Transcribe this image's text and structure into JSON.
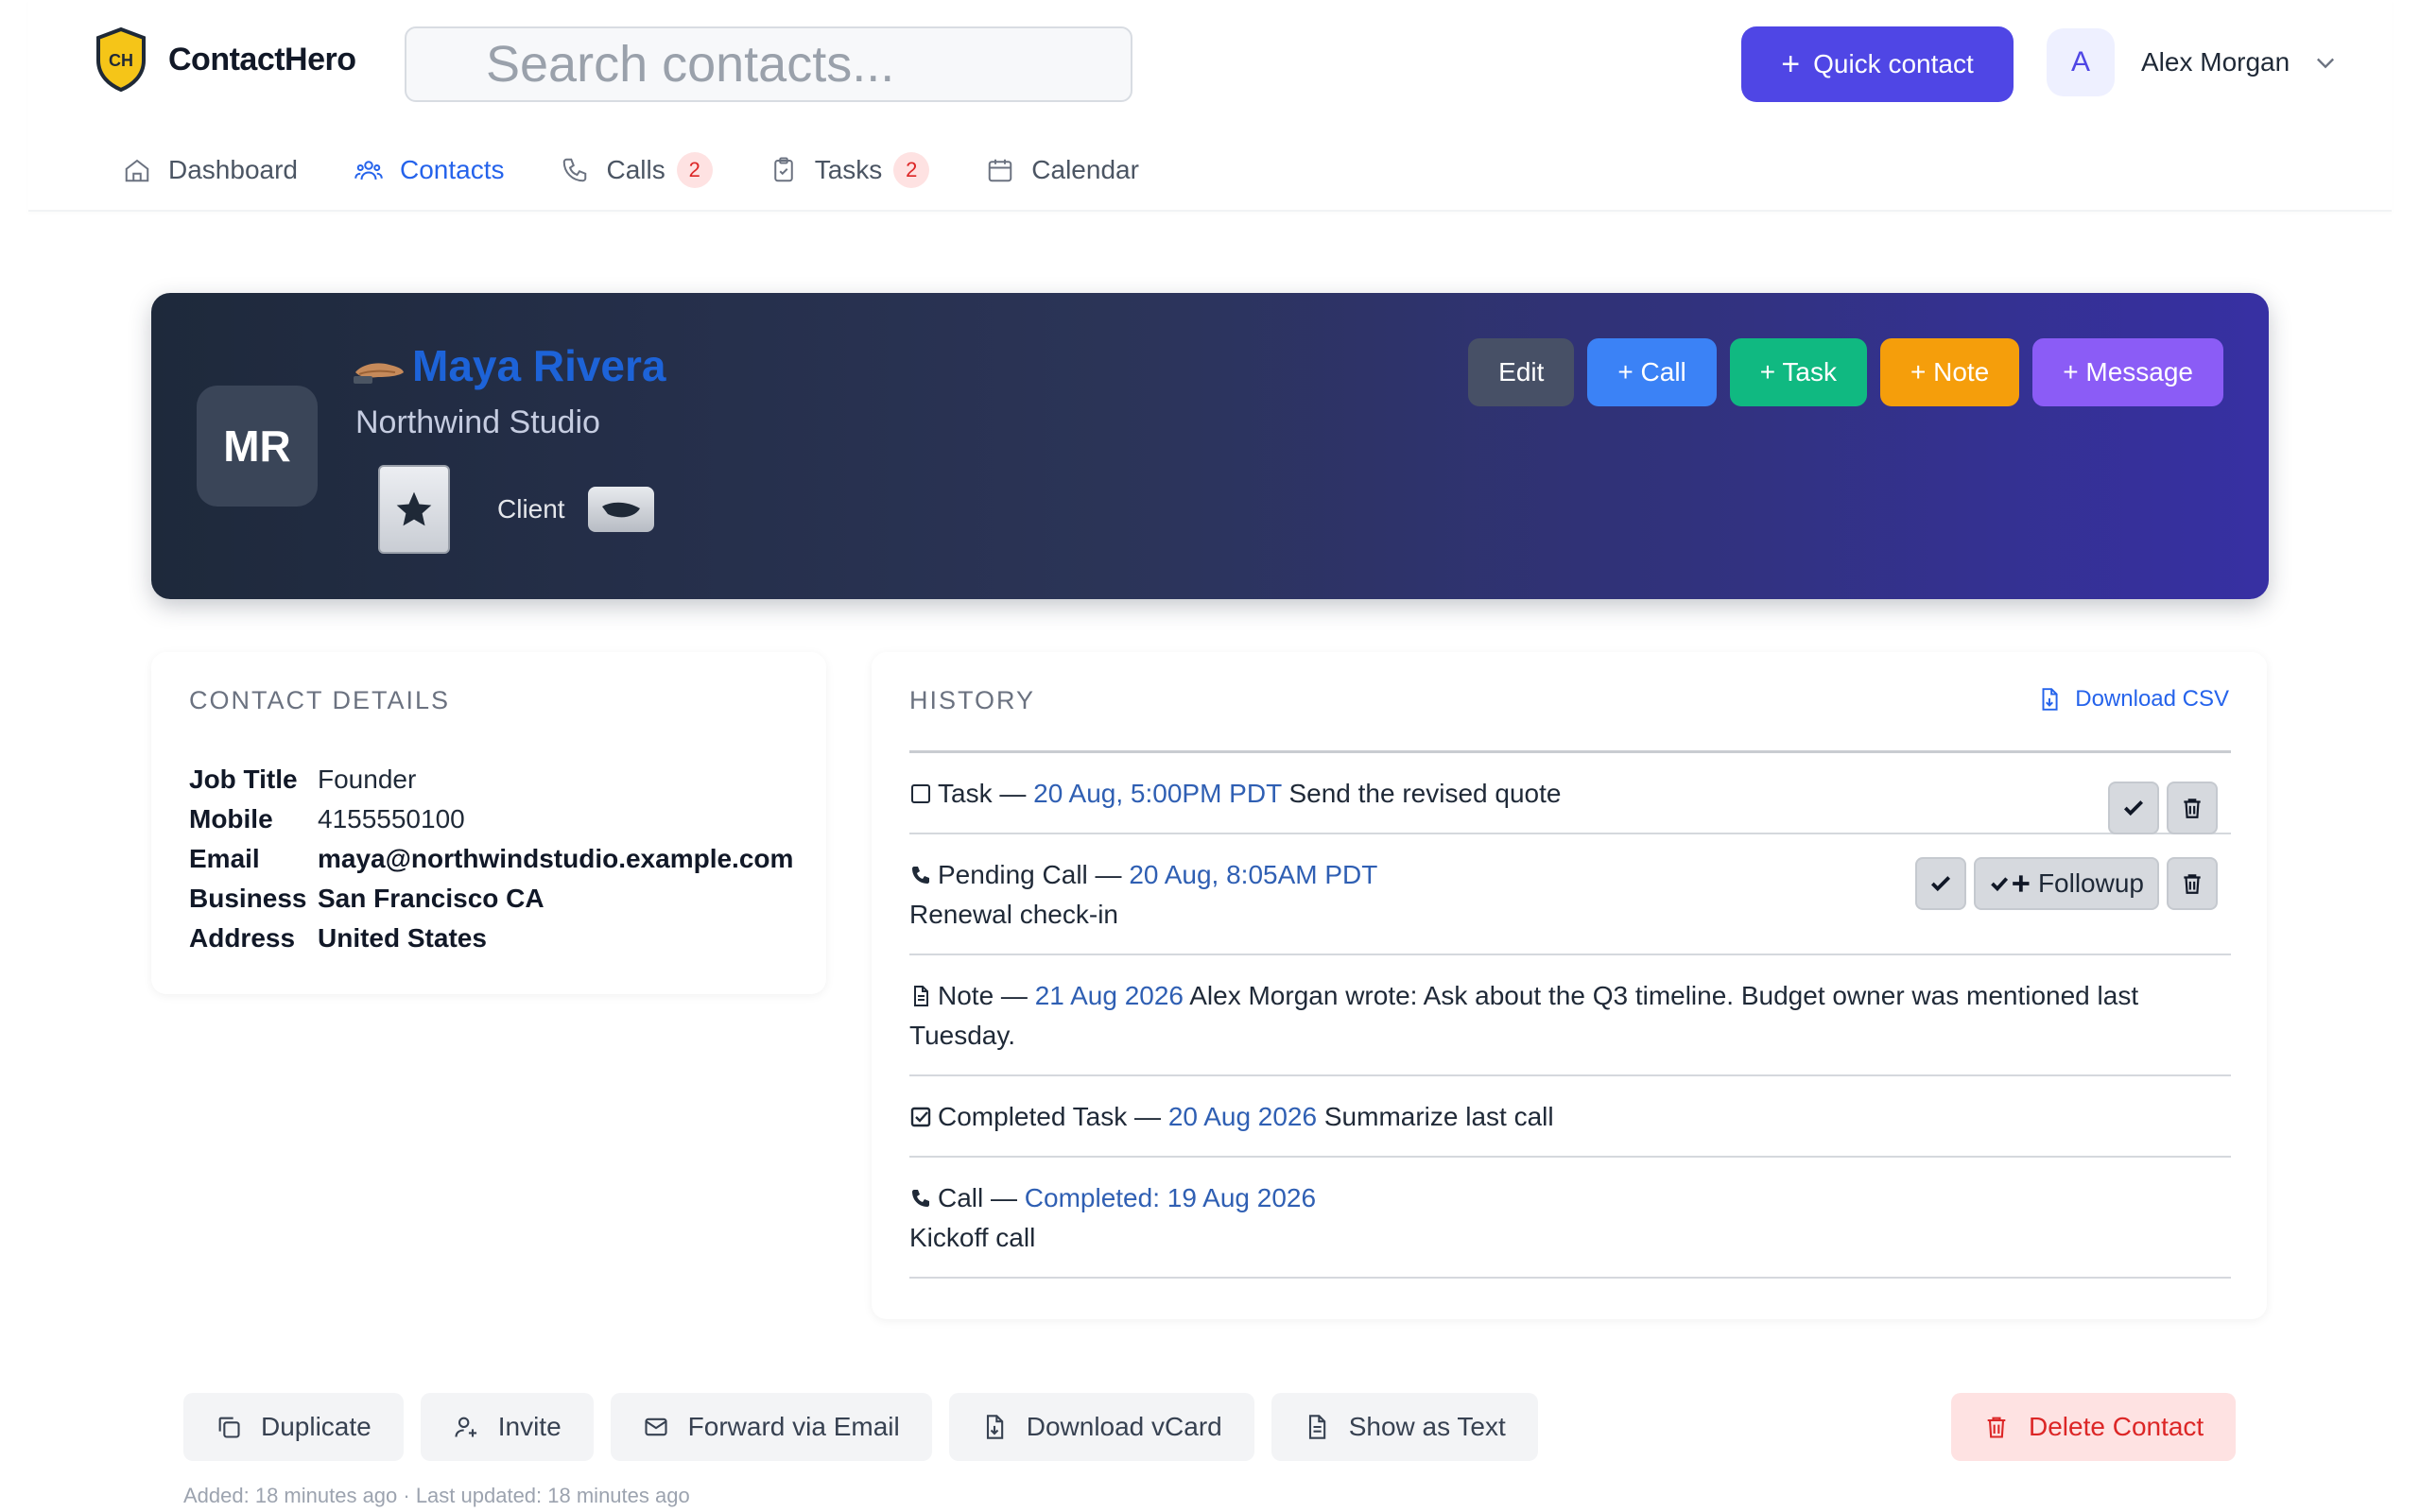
{
  "app": {
    "brand": "ContactHero",
    "logo_initials": "CH",
    "search_placeholder": "Search contacts...",
    "quick_contact": "Quick contact",
    "user": {
      "initial": "A",
      "name": "Alex Morgan"
    }
  },
  "nav": [
    {
      "label": "Dashboard",
      "icon": "home-icon"
    },
    {
      "label": "Contacts",
      "icon": "users-icon",
      "active": true
    },
    {
      "label": "Calls",
      "icon": "phone-icon",
      "badge": "2"
    },
    {
      "label": "Tasks",
      "icon": "clipboard-icon",
      "badge": "2"
    },
    {
      "label": "Calendar",
      "icon": "calendar-icon"
    }
  ],
  "contact": {
    "initials": "MR",
    "name": "Maya Rivera",
    "company": "Northwind Studio",
    "tag": "Client"
  },
  "hero_actions": {
    "edit": "Edit",
    "call": "+ Call",
    "task": "+ Task",
    "note": "+ Note",
    "message": "+ Message"
  },
  "details": {
    "title": "CONTACT DETAILS",
    "rows": [
      {
        "label": "Job Title",
        "value": "Founder"
      },
      {
        "label": "Mobile",
        "value": "4155550100"
      },
      {
        "label": "Email",
        "value": "maya@northwindstudio.example.com"
      },
      {
        "label": "Business",
        "value": "San Francisco CA"
      },
      {
        "label": "Address",
        "value": "United States"
      }
    ]
  },
  "history": {
    "title": "HISTORY",
    "download_csv": "Download CSV",
    "items": [
      {
        "type": "Task —",
        "date": "20 Aug, 5:00PM PDT",
        "text": "Send the revised quote"
      },
      {
        "type": "Pending Call —",
        "date": "20 Aug, 8:05AM PDT",
        "text": "Renewal check-in",
        "followup": "Followup"
      },
      {
        "type": "Note —",
        "date": "21 Aug 2026",
        "text": "Alex Morgan wrote: Ask about the Q3 timeline. Budget owner was mentioned last Tuesday."
      },
      {
        "type": "Completed Task —",
        "date": "20 Aug 2026",
        "text": "Summarize last call"
      },
      {
        "type": "Call —",
        "date": "Completed: 19 Aug 2026",
        "text": "Kickoff call"
      }
    ]
  },
  "footer": {
    "duplicate": "Duplicate",
    "invite": "Invite",
    "forward": "Forward via Email",
    "vcard": "Download vCard",
    "show_text": "Show as Text",
    "delete": "Delete Contact",
    "meta": "Added: 18 minutes ago · Last updated: 18 minutes ago"
  },
  "colors": {
    "accent": "#4f46e5",
    "link": "#2563eb",
    "call": "#3b82f6",
    "task": "#10b981",
    "note": "#f59e0b",
    "message": "#8b5cf6",
    "danger": "#dc2626"
  }
}
